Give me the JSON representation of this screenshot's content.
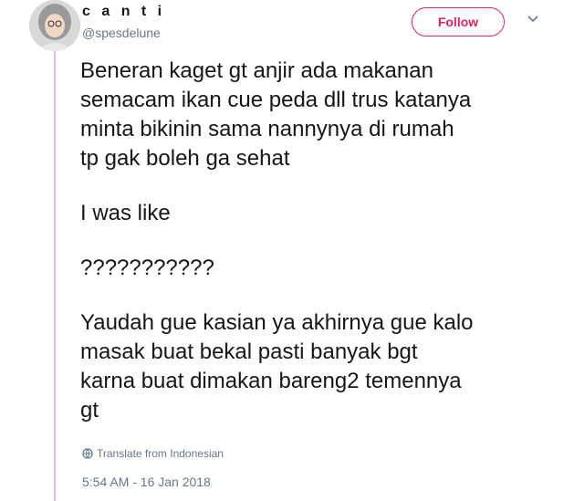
{
  "user": {
    "display_name": "c a n t i",
    "handle": "@spesdelune",
    "avatar_icon": "user-avatar"
  },
  "actions": {
    "follow_label": "Follow",
    "follow_color": "#e0245e",
    "more_icon": "chevron-down-icon"
  },
  "tweet": {
    "lines_p1": [
      "Beneran kaget gt anjir ada makanan",
      "semacam ikan cue peda dll trus katanya",
      "minta bikinin sama nannynya di rumah",
      "tp gak boleh ga sehat"
    ],
    "p2": "I was like",
    "p3": "???????????",
    "lines_p4": [
      "Yaudah gue kasian ya akhirnya gue kalo",
      "masak buat bekal pasti banyak bgt",
      "karna buat dimakan bareng2 temennya",
      "gt"
    ]
  },
  "translate_label": "Translate from Indonesian",
  "timestamp": "5:54 AM - 16 Jan 2018",
  "colors": {
    "thread_line": "#e1bee7",
    "secondary_text": "#657786"
  }
}
